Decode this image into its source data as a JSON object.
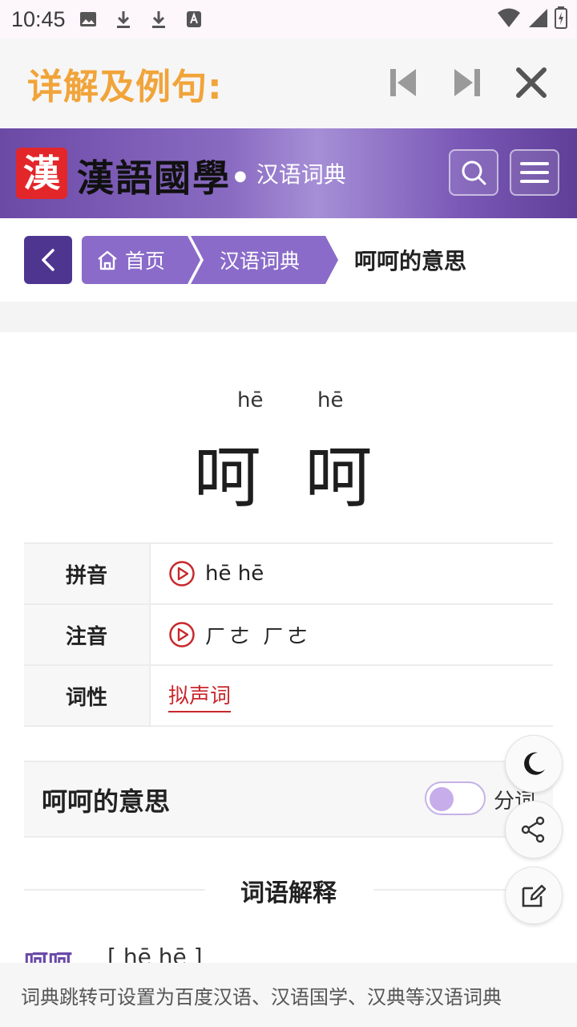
{
  "status_bar": {
    "time": "10:45"
  },
  "detail_header": {
    "title": "详解及例句:"
  },
  "site": {
    "logo_char": "漢",
    "name": "漢語國學",
    "section": "汉语词典"
  },
  "breadcrumb": {
    "home": "首页",
    "dict": "汉语词典",
    "current": "呵呵的意思"
  },
  "word": {
    "chars": "呵 呵",
    "pinyin_1": "hē",
    "pinyin_2": "hē"
  },
  "info": [
    {
      "key": "拼音",
      "value": "hē hē"
    },
    {
      "key": "注音",
      "value": "ㄏㄜ ㄏㄜ"
    },
    {
      "key": "词性",
      "value": "拟声词"
    }
  ],
  "meaning": {
    "title": "呵呵的意思",
    "toggle_label": "分词"
  },
  "section_heading": "词语解释",
  "entry": {
    "word": "呵呵",
    "pinyin": "[ hē hē ]"
  },
  "bottom_tip": "词典跳转可设置为百度汉语、汉语国学、汉典等汉语词典",
  "colors": {
    "accent_orange": "#f1a43a",
    "purple": "#8a6bc9",
    "dark_purple": "#4e3590",
    "red": "#c8282c"
  }
}
